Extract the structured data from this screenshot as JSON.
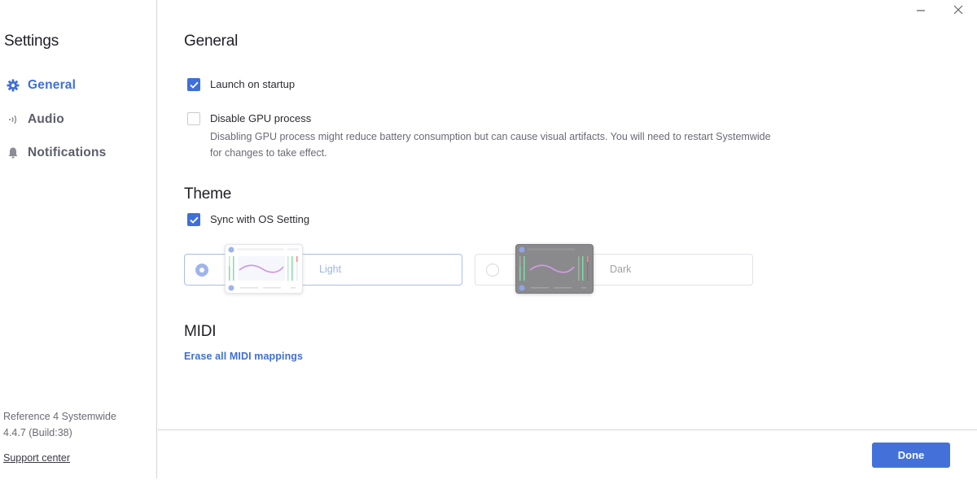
{
  "window": {
    "minimize_icon": "minimize-icon",
    "close_icon": "close-icon"
  },
  "sidebar": {
    "title": "Settings",
    "items": [
      {
        "label": "General",
        "icon": "gear-icon",
        "active": true
      },
      {
        "label": "Audio",
        "icon": "speaker-icon",
        "active": false
      },
      {
        "label": "Notifications",
        "icon": "bell-icon",
        "active": false
      }
    ],
    "app_name": "Reference 4 Systemwide",
    "version": "4.4.7 (Build:38)",
    "support_link": "Support center"
  },
  "general": {
    "title": "General",
    "launch_on_startup": {
      "label": "Launch on startup",
      "checked": true
    },
    "disable_gpu": {
      "label": "Disable GPU process",
      "checked": false,
      "description": "Disabling GPU process might reduce battery consumption but can cause visual artifacts. You will need to restart Systemwide for changes to take effect."
    }
  },
  "theme": {
    "title": "Theme",
    "sync_os": {
      "label": "Sync with OS Setting",
      "checked": true
    },
    "options": [
      {
        "label": "Light",
        "selected": true
      },
      {
        "label": "Dark",
        "selected": false
      }
    ]
  },
  "midi": {
    "title": "MIDI",
    "erase_link": "Erase all MIDI mappings"
  },
  "footer": {
    "done_label": "Done"
  },
  "colors": {
    "accent": "#3f6fd8",
    "button": "#4471d9"
  }
}
